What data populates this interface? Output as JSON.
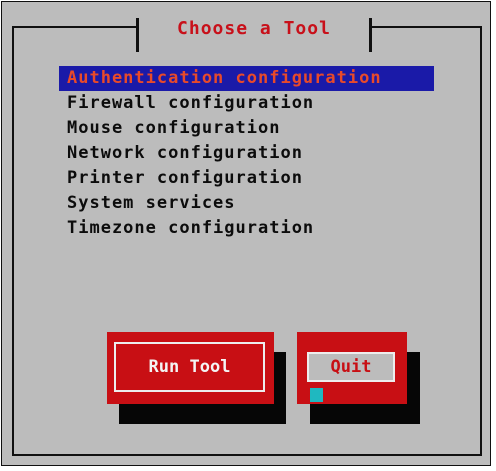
{
  "dialog": {
    "title": "Choose a Tool"
  },
  "tools": [
    "Authentication configuration",
    "Firewall configuration",
    "Mouse configuration",
    "Network configuration",
    "Printer configuration",
    "System services",
    "Timezone configuration"
  ],
  "selected_index": 0,
  "buttons": {
    "run": "Run Tool",
    "quit": "Quit"
  },
  "colors": {
    "dialog_background": "#bcbcbc",
    "title_text": "#c8101a",
    "selection_background": "#1a1aa8",
    "selection_text": "#e84a2a",
    "button_background": "#c80f14",
    "button_shadow": "#060606",
    "cursor": "#1fb8c0"
  }
}
